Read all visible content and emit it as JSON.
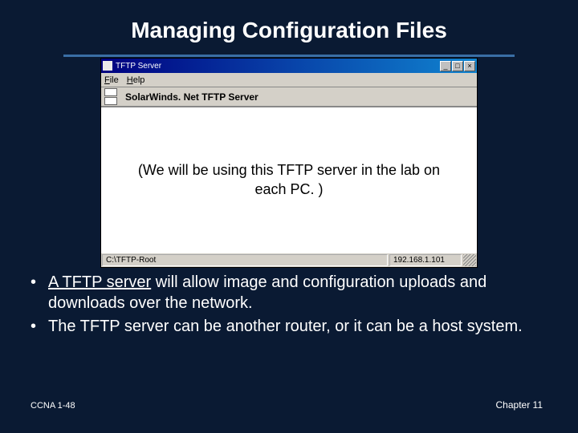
{
  "heading": "Managing Configuration Files",
  "tftp_window": {
    "title": "TFTP Server",
    "menu": {
      "file": "File",
      "help": "Help"
    },
    "app_name": "SolarWinds. Net TFTP Server",
    "note": "(We will be using this TFTP server in the lab on each PC. )",
    "status_left": "C:\\TFTP-Root",
    "status_right": "192.168.1.101",
    "btn_minimize": "_",
    "btn_maximize": "□",
    "btn_close": "×"
  },
  "bullets": {
    "b1_prefix": "A TFTP server",
    "b1_rest": " will allow image and configuration uploads and downloads over the network.",
    "b2": "The TFTP server can be another router, or it can be a host system."
  },
  "footer": {
    "left": "CCNA 1-48",
    "right": "Chapter 11"
  }
}
